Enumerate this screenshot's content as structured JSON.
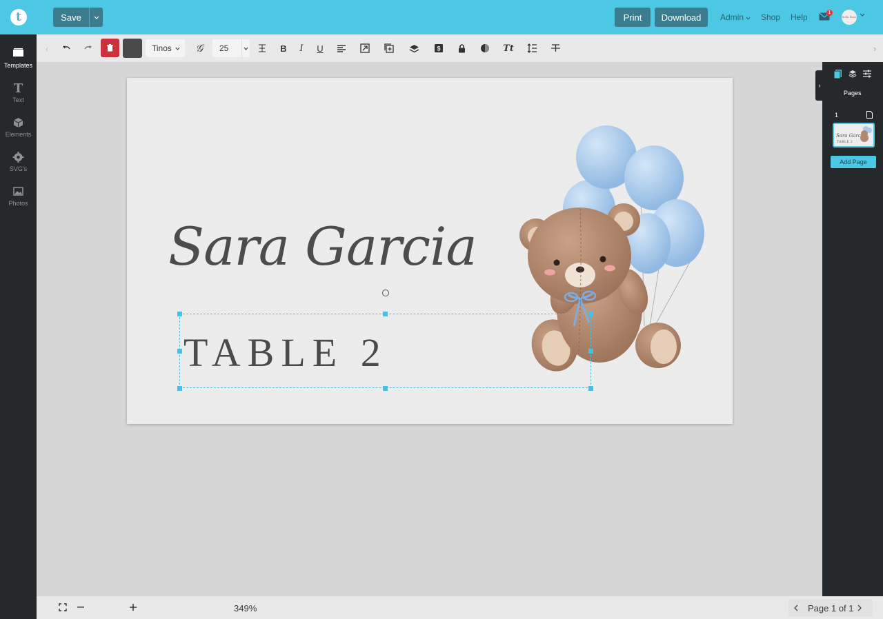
{
  "app": {
    "logo_letter": "t"
  },
  "topbar": {
    "save_label": "Save",
    "print_label": "Print",
    "download_label": "Download",
    "admin_label": "Admin",
    "shop_label": "Shop",
    "help_label": "Help",
    "notification_count": "1",
    "avatar_text": "Bella Rosa",
    "accent_color": "#4dc8e4",
    "button_color": "#3b7c8e"
  },
  "sidebar": {
    "items": [
      {
        "label": "Templates",
        "icon": "templates-icon",
        "active": true
      },
      {
        "label": "Text",
        "icon": "text-icon",
        "active": false
      },
      {
        "label": "Elements",
        "icon": "elements-icon",
        "active": false
      },
      {
        "label": "SVG's",
        "icon": "svg-icon",
        "active": false
      },
      {
        "label": "Photos",
        "icon": "photos-icon",
        "active": false
      }
    ]
  },
  "toolbar": {
    "font_name": "Tinos",
    "font_size": "25",
    "color_value": "#4a4a4a",
    "delete_color": "#c8333e"
  },
  "canvas": {
    "name_text": "Sara Garcia",
    "table_text": "TABLE 2",
    "background": "#ececec"
  },
  "right_panel": {
    "pages_label": "Pages",
    "page_number": "1",
    "add_page_label": "Add Page"
  },
  "bottombar": {
    "zoom": "349%",
    "page_label": "Page 1 of 1"
  }
}
